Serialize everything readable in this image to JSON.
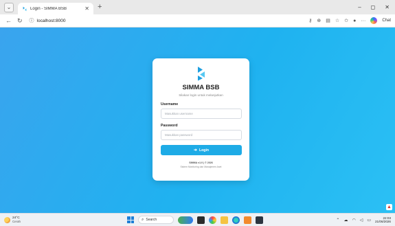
{
  "browser": {
    "tab_title": "Login - SIMMA BSB",
    "tab_close": "✕",
    "new_tab": "+",
    "url": "localhost:8000",
    "chat_label": "Chat",
    "win_minimize": "–",
    "win_maximize": "◻",
    "win_close": "✕"
  },
  "login": {
    "app_name": "SIMMA BSB",
    "subtitle": "Silakan login untuk melanjutkan",
    "username_label": "Username",
    "username_placeholder": "Masukkan username",
    "username_value": "",
    "password_label": "Password",
    "password_placeholder": "Masukkan password",
    "password_value": "",
    "login_button": "Login",
    "version": "SIMMA v1.0 | © 2026",
    "description": "Sistem Monitoring dan Manajemen Aset"
  },
  "taskbar": {
    "temperature": "24°C",
    "weather": "Cerah",
    "search_label": "Search",
    "time": "22:03",
    "date": "21/06/2026"
  },
  "colors": {
    "accent": "#1eabe6",
    "page_background": "#22b0f0",
    "logo_primary": "#1e9fe0",
    "logo_secondary": "#57c8f2"
  }
}
